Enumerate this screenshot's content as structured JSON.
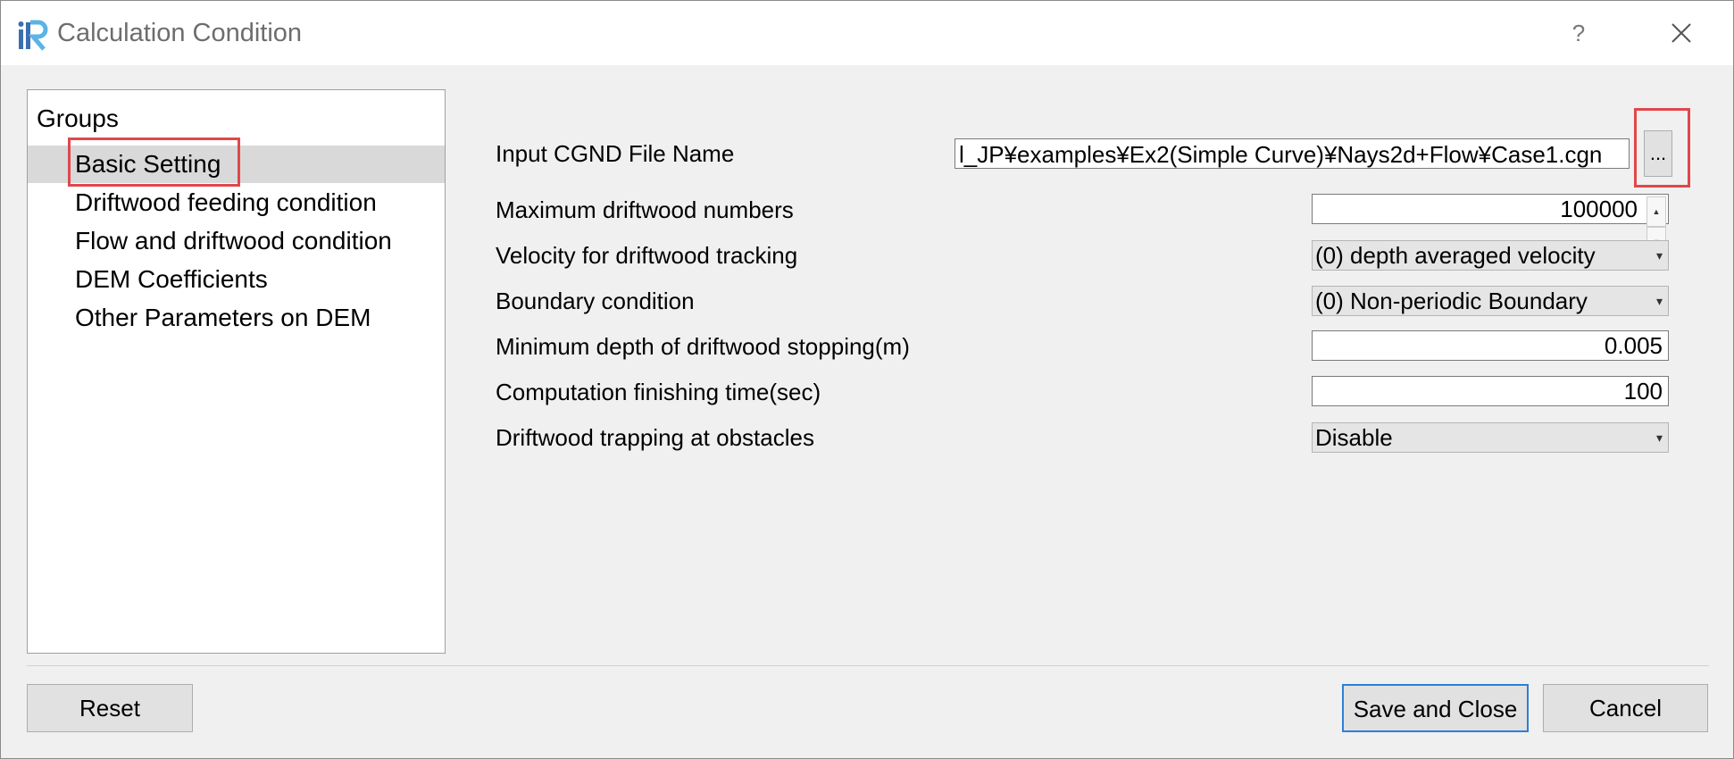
{
  "window": {
    "title": "Calculation Condition",
    "help_label": "?"
  },
  "groups": {
    "title": "Groups",
    "items": [
      {
        "label": "Basic Setting",
        "selected": true
      },
      {
        "label": "Driftwood feeding condition",
        "selected": false
      },
      {
        "label": "Flow and driftwood condition",
        "selected": false
      },
      {
        "label": "DEM Coefficients",
        "selected": false
      },
      {
        "label": "Other Parameters on DEM",
        "selected": false
      }
    ]
  },
  "form": {
    "input_cgnd": {
      "label": "Input CGND File Name",
      "value": "l_JP¥examples¥Ex2(Simple Curve)¥Nays2d+Flow¥Case1.cgn",
      "browse_label": "..."
    },
    "max_driftwood": {
      "label": "Maximum driftwood numbers",
      "value": "100000"
    },
    "velocity": {
      "label": "Velocity for driftwood tracking",
      "value": "(0) depth averaged velocity"
    },
    "boundary": {
      "label": "Boundary condition",
      "value": "(0) Non-periodic Boundary"
    },
    "min_depth": {
      "label": "Minimum depth of driftwood stopping(m)",
      "value": "0.005"
    },
    "finish_time": {
      "label": "Computation finishing time(sec)",
      "value": "100"
    },
    "trapping": {
      "label": "Driftwood trapping at obstacles",
      "value": "Disable"
    }
  },
  "buttons": {
    "reset": "Reset",
    "save_close": "Save and Close",
    "cancel": "Cancel"
  },
  "colors": {
    "highlight": "#e0474c",
    "default_button_border": "#2d7fd6",
    "selected_row": "#d9d9d9"
  }
}
